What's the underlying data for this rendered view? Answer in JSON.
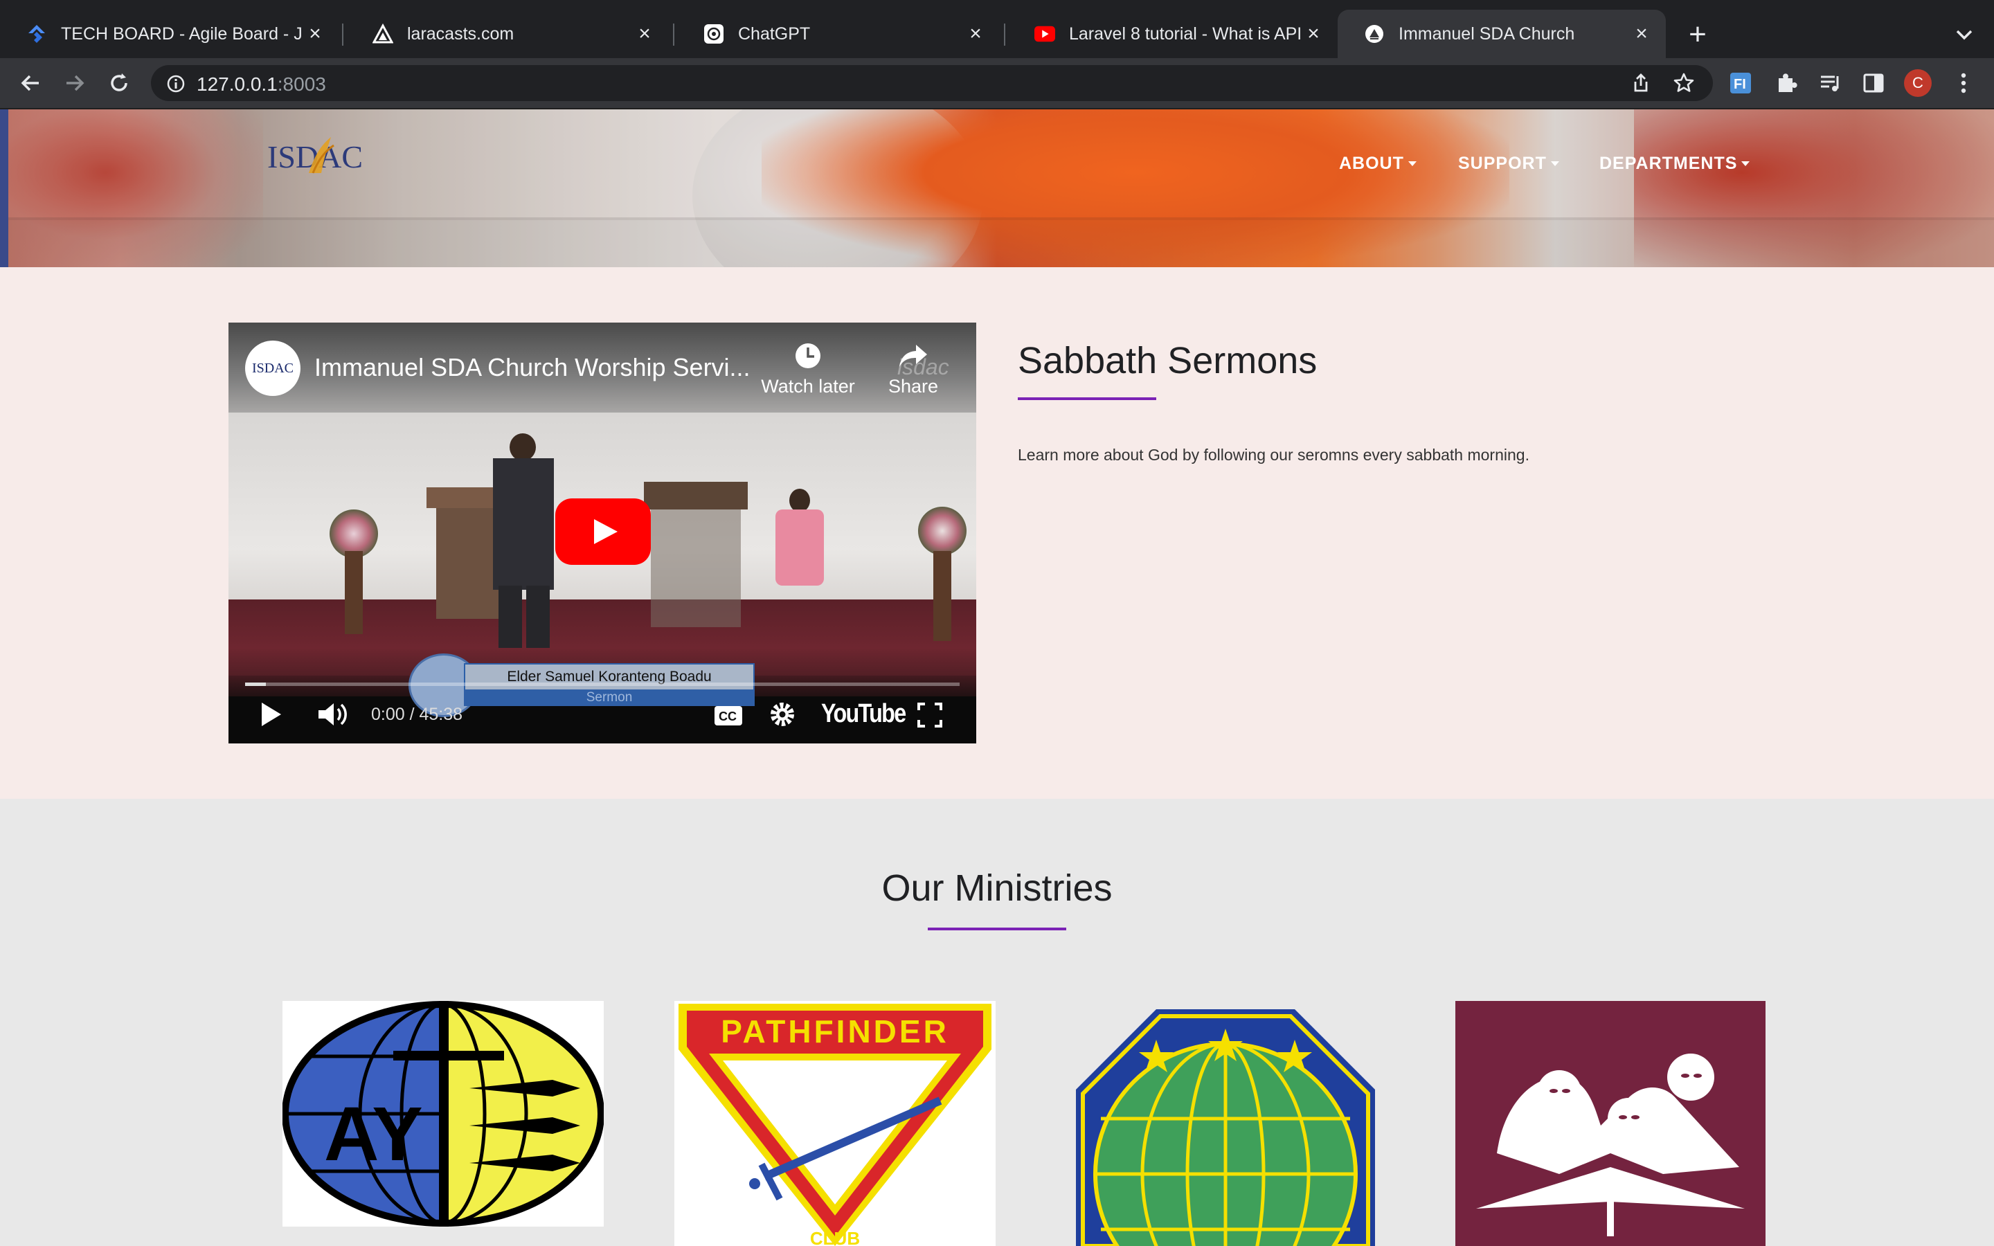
{
  "browser": {
    "tabs": [
      {
        "title": "TECH BOARD - Agile Board - J",
        "icon": "jira-icon"
      },
      {
        "title": "laracasts.com",
        "icon": "laracasts-icon"
      },
      {
        "title": "ChatGPT",
        "icon": "chatgpt-icon"
      },
      {
        "title": "Laravel 8 tutorial - What is API",
        "icon": "youtube-icon"
      },
      {
        "title": "Immanuel SDA Church",
        "icon": "sda-church-icon",
        "active": true
      }
    ],
    "url_host": "127.0.0.1",
    "url_port": ":8003",
    "profile_initial": "C"
  },
  "site": {
    "logo_text": "ISDAC",
    "nav": [
      {
        "label": "ABOUT"
      },
      {
        "label": "SUPPORT"
      },
      {
        "label": "DEPARTMENTS"
      }
    ]
  },
  "video": {
    "channel_avatar_text": "ISDAC",
    "title": "Immanuel SDA Church Worship Servi...",
    "watch_later": "Watch later",
    "share": "Share",
    "watermark": "isdac",
    "lower_third_name": "Elder Samuel Koranteng Boadu",
    "lower_third_role": "Sermon",
    "time": "0:00 / 45:38",
    "youtube_logo": "YouTube"
  },
  "sermons": {
    "heading": "Sabbath Sermons",
    "text": "Learn more about God by following our seromns every sabbath morning."
  },
  "ministries": {
    "heading": "Our Ministries",
    "items": [
      {
        "name": "ay-logo",
        "text": "AY"
      },
      {
        "name": "pathfinder-logo",
        "text": "PATHFINDER",
        "sub": "CLUB"
      },
      {
        "name": "globe-logo"
      },
      {
        "name": "womens-ministries-logo"
      }
    ]
  },
  "colors": {
    "accent": "#7b22b5",
    "sermons_bg": "#f7ebe9",
    "ministries_bg": "#e8e8e8"
  }
}
